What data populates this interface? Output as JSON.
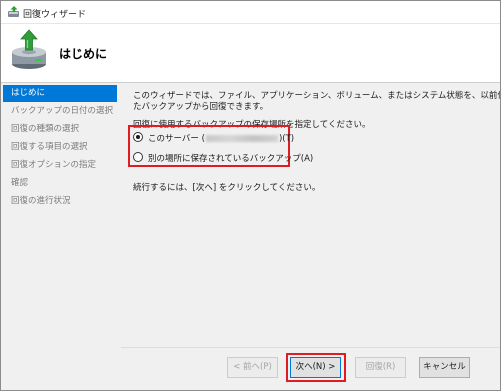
{
  "window": {
    "title": "回復ウィザード"
  },
  "header": {
    "title": "はじめに"
  },
  "sidebar": {
    "items": [
      {
        "label": "はじめに"
      },
      {
        "label": "バックアップの日付の選択"
      },
      {
        "label": "回復の種類の選択"
      },
      {
        "label": "回復する項目の選択"
      },
      {
        "label": "回復オプションの指定"
      },
      {
        "label": "確認"
      },
      {
        "label": "回復の進行状況"
      }
    ]
  },
  "main": {
    "intro_line1": "このウィザードでは、ファイル、アプリケーション、ボリューム、またはシステム状態を、以前作成し",
    "intro_line2": "たバックアップから回復できます。",
    "location_prompt": "回復に使用するバックアップの保存場所を指定してください。",
    "option_this_server_prefix": "このサーバー (",
    "option_this_server_suffix": ")(T)",
    "option_other_location": "別の場所に保存されているバックアップ(A)",
    "option_selected": "this-server",
    "continue_text": "続行するには、[次へ] をクリックしてください。"
  },
  "footer": {
    "back": "< 前へ(P)",
    "next": "次へ(N) >",
    "recover": "回復(R)",
    "cancel": "キャンセル"
  },
  "colors": {
    "selection": "#0078d7",
    "highlight_box": "#e21b22"
  }
}
